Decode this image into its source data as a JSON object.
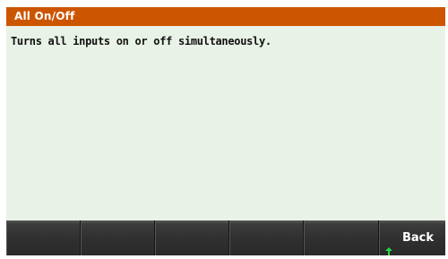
{
  "title_bar": {
    "title": "All On/Off"
  },
  "content": {
    "description": "Turns all inputs on or off simultaneously."
  },
  "softkeys": [
    {
      "label": ""
    },
    {
      "label": ""
    },
    {
      "label": ""
    },
    {
      "label": ""
    },
    {
      "label": ""
    },
    {
      "label": "Back",
      "icon": "up-arrow-icon"
    }
  ],
  "colors": {
    "title_bar": "#cc5500",
    "screen_background": "#e9f2e6",
    "softkey_background": "#2e2e2e",
    "arrow": "#22dd44"
  }
}
